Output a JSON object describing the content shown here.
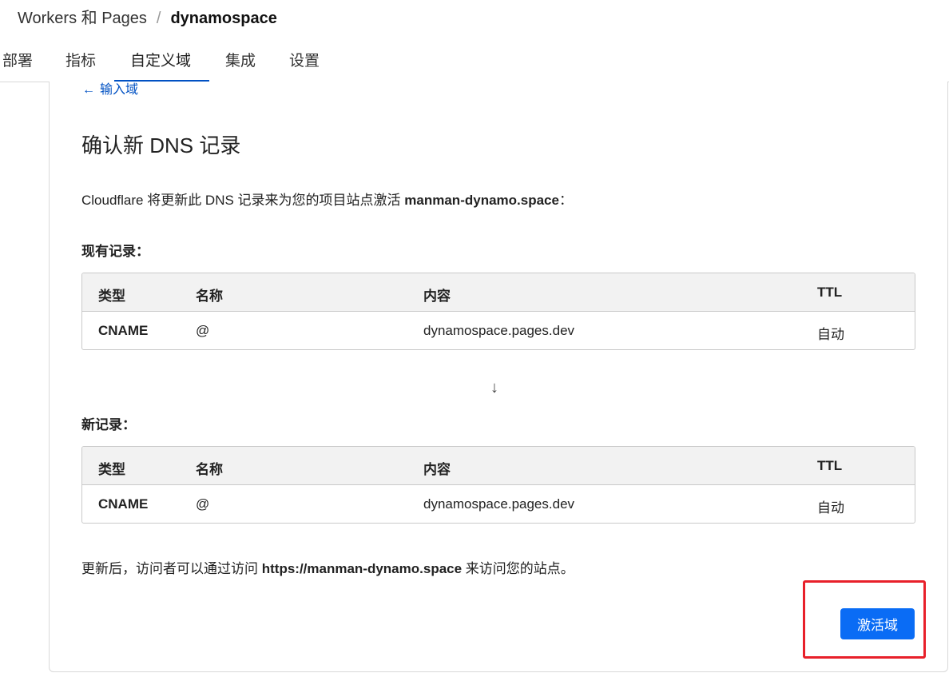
{
  "breadcrumb": {
    "parent": "Workers 和 Pages",
    "separator": "/",
    "current": "dynamospace"
  },
  "tabs": [
    {
      "label": "部署",
      "active": false
    },
    {
      "label": "指标",
      "active": false
    },
    {
      "label": "自定义域",
      "active": true
    },
    {
      "label": "集成",
      "active": false
    },
    {
      "label": "设置",
      "active": false
    }
  ],
  "back_link": {
    "icon": "arrow-left-icon",
    "label": "输入域"
  },
  "heading": "确认新 DNS 记录",
  "description": {
    "prefix": "Cloudflare 将更新此 DNS 记录来为您的项目站点激活 ",
    "domain": "manman-dynamo.space",
    "suffix": "："
  },
  "existing_records": {
    "title": "现有记录：",
    "columns": [
      "类型",
      "名称",
      "内容",
      "TTL"
    ],
    "rows": [
      {
        "type": "CNAME",
        "name": "@",
        "content": "dynamospace.pages.dev",
        "ttl": "自动"
      }
    ]
  },
  "arrow_icon": "arrow-down-icon",
  "arrow_glyph": "↓",
  "new_records": {
    "title": "新记录：",
    "columns": [
      "类型",
      "名称",
      "内容",
      "TTL"
    ],
    "rows": [
      {
        "type": "CNAME",
        "name": "@",
        "content": "dynamospace.pages.dev",
        "ttl": "自动"
      }
    ]
  },
  "footer_note": {
    "prefix": "更新后，访问者可以通过访问 ",
    "url": "https://manman-dynamo.space",
    "suffix": " 来访问您的站点。"
  },
  "activate_button": {
    "label": "激活域",
    "color": "#0a6cf5"
  },
  "colors": {
    "accent": "#0051c3",
    "highlight": "#e8202a"
  }
}
